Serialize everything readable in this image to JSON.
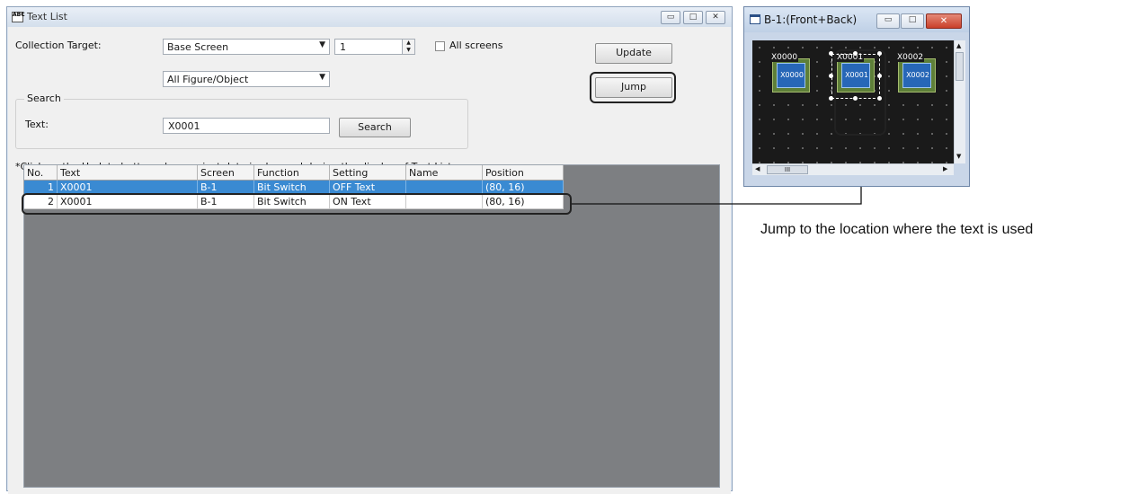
{
  "window": {
    "title": "Text List",
    "app_icon_text": "ABC"
  },
  "collection": {
    "label": "Collection Target:",
    "screen_type": "Base Screen",
    "screen_number": "1",
    "all_screens_label": "All screens",
    "all_screens_checked": false,
    "figure_filter": "All Figure/Object"
  },
  "search": {
    "group_label": "Search",
    "text_label": "Text:",
    "text_value": "X0001",
    "button_label": "Search"
  },
  "buttons": {
    "update": "Update",
    "jump": "Jump"
  },
  "note": "*Click on the Update button when project data is changed during the display of Text List.",
  "table": {
    "columns": [
      "No.",
      "Text",
      "Screen",
      "Function",
      "Setting",
      "Name",
      "Position"
    ],
    "rows": [
      {
        "no": "1",
        "text": "X0001",
        "screen": "B-1",
        "function": "Bit Switch",
        "setting": "OFF Text",
        "name": "",
        "position": "(80, 16)",
        "selected": true
      },
      {
        "no": "2",
        "text": "X0001",
        "screen": "B-1",
        "function": "Bit Switch",
        "setting": "ON Text",
        "name": "",
        "position": "(80, 16)",
        "selected": false
      }
    ]
  },
  "preview": {
    "title": "B-1:(Front+Back)",
    "scroll_thumb_label": "III",
    "switches": [
      {
        "top_label": "X0000",
        "label": "X0000",
        "selected": false
      },
      {
        "top_label": "X0001",
        "label": "X0001",
        "selected": true
      },
      {
        "top_label": "X0002",
        "label": "X0002",
        "selected": false
      }
    ]
  },
  "annotation": "Jump to the location where the text is used",
  "colors": {
    "selection": "#3a8ad2",
    "grid_background": "#7d7f82",
    "switch_fill": "#2767b7",
    "switch_frame": "#5e7f38"
  }
}
